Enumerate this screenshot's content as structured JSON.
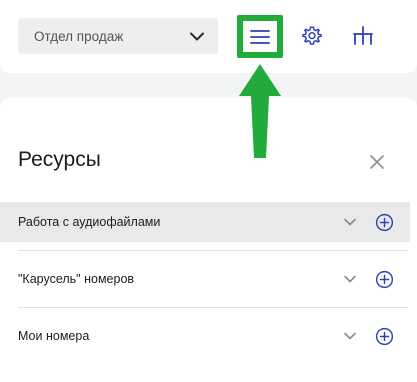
{
  "header": {
    "department_select": {
      "selected": "Отдел продаж"
    },
    "icons": {
      "menu": "hamburger-menu-icon",
      "settings": "gear-icon",
      "structure": "org-structure-icon",
      "dropdown": "chevron-down-icon"
    }
  },
  "annotation": {
    "highlight_color": "#22aa3a"
  },
  "panel": {
    "title": "Ресурсы",
    "items": [
      {
        "label": "Работа с аудиофайлами",
        "active": true
      },
      {
        "label": "\"Карусель\" номеров",
        "active": false
      },
      {
        "label": "Мои номера",
        "active": false
      }
    ]
  },
  "colors": {
    "accent": "#2f3fb8",
    "muted_icon": "#8a8a8a",
    "active_row_bg": "#e9e9e9"
  }
}
